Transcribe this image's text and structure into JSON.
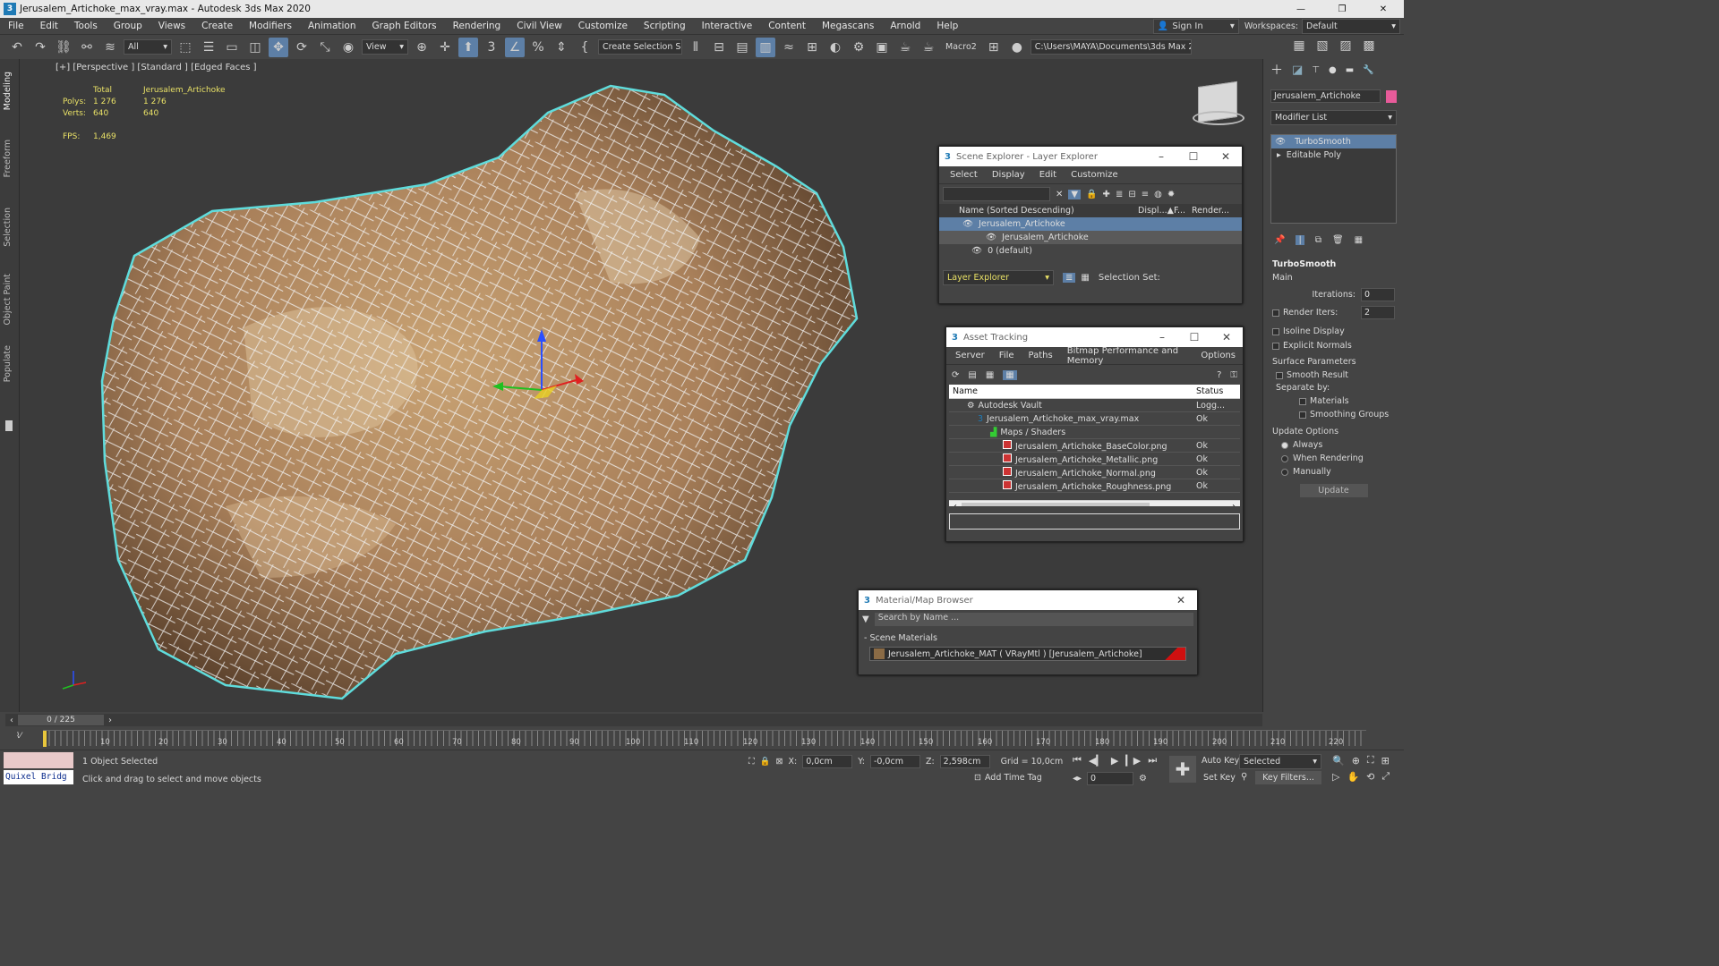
{
  "app": {
    "title": "Jerusalem_Artichoke_max_vray.max - Autodesk 3ds Max 2020",
    "window_controls": [
      "—",
      "❐",
      "✕"
    ]
  },
  "menu": [
    "File",
    "Edit",
    "Tools",
    "Group",
    "Views",
    "Create",
    "Modifiers",
    "Animation",
    "Graph Editors",
    "Rendering",
    "Civil View",
    "Customize",
    "Scripting",
    "Interactive",
    "Content",
    "Megascans",
    "Arnold",
    "Help"
  ],
  "account": {
    "sign_in": "Sign In",
    "workspaces_label": "Workspaces:",
    "workspace": "Default"
  },
  "toolbar": {
    "filter": "All",
    "view": "View",
    "selection_set": "Create Selection Se",
    "macro": "Macro2",
    "path": "C:\\Users\\MAYA\\Documents\\3ds Max 2020"
  },
  "left_tabs": [
    "Modeling",
    "Freeform",
    "Selection",
    "Object Paint",
    "Populate"
  ],
  "viewport": {
    "label": "[+] [Perspective ] [Standard ] [Edged Faces ]",
    "stats": {
      "col_total": "Total",
      "col_obj": "Jerusalem_Artichoke",
      "polys_label": "Polys:",
      "polys_total": "1 276",
      "polys_obj": "1 276",
      "verts_label": "Verts:",
      "verts_total": "640",
      "verts_obj": "640",
      "fps_label": "FPS:",
      "fps": "1,469"
    }
  },
  "scene_explorer": {
    "title": "Scene Explorer - Layer Explorer",
    "menu": [
      "Select",
      "Display",
      "Edit",
      "Customize"
    ],
    "col_name": "Name (Sorted Descending)",
    "col_disp": "Displ...▲",
    "col_f": "F...",
    "col_render": "Render...",
    "rows": [
      "Jerusalem_Artichoke",
      "Jerusalem_Artichoke",
      "0 (default)"
    ],
    "footer_layer": "Layer Explorer",
    "footer_sel": "Selection Set:"
  },
  "asset_tracking": {
    "title": "Asset Tracking",
    "menu": [
      "Server",
      "File",
      "Paths",
      "Bitmap Performance and Memory",
      "Options"
    ],
    "col_name": "Name",
    "col_status": "Status",
    "rows": [
      {
        "name": "Autodesk Vault",
        "status": "Logg..."
      },
      {
        "name": "Jerusalem_Artichoke_max_vray.max",
        "status": "Ok"
      },
      {
        "name": "Maps / Shaders",
        "status": ""
      },
      {
        "name": "Jerusalem_Artichoke_BaseColor.png",
        "status": "Ok"
      },
      {
        "name": "Jerusalem_Artichoke_Metallic.png",
        "status": "Ok"
      },
      {
        "name": "Jerusalem_Artichoke_Normal.png",
        "status": "Ok"
      },
      {
        "name": "Jerusalem_Artichoke_Roughness.png",
        "status": "Ok"
      }
    ]
  },
  "material_browser": {
    "title": "Material/Map Browser",
    "search_placeholder": "Search by Name ...",
    "section": "- Scene Materials",
    "item": "Jerusalem_Artichoke_MAT ( VRayMtl ) [Jerusalem_Artichoke]"
  },
  "command_panel": {
    "object_name": "Jerusalem_Artichoke",
    "modifier_list": "Modifier List",
    "stack": [
      "TurboSmooth",
      "Editable Poly"
    ],
    "rollout": "TurboSmooth",
    "main": "Main",
    "iterations_label": "Iterations:",
    "iterations": "0",
    "render_iters_label": "Render Iters:",
    "render_iters": "2",
    "isoline": "Isoline Display",
    "explicit": "Explicit Normals",
    "surface": "Surface Parameters",
    "smooth_result": "Smooth Result",
    "separate": "Separate by:",
    "materials": "Materials",
    "smoothing": "Smoothing Groups",
    "update_options": "Update Options",
    "always": "Always",
    "when_rendering": "When Rendering",
    "manually": "Manually",
    "update_btn": "Update"
  },
  "timeline": {
    "frame": "0 / 225",
    "ticks": [
      "10",
      "20",
      "30",
      "40",
      "50",
      "60",
      "70",
      "80",
      "90",
      "100",
      "110",
      "120",
      "130",
      "140",
      "150",
      "160",
      "170",
      "180",
      "190",
      "200",
      "210",
      "220"
    ]
  },
  "status": {
    "quixel": "Quixel Bridg",
    "selected_count": "1 Object Selected",
    "prompt": "Click and drag to select and move objects",
    "x_label": "X:",
    "x": "0,0cm",
    "y_label": "Y:",
    "y": "-0,0cm",
    "z_label": "Z:",
    "z": "2,598cm",
    "grid": "Grid = 10,0cm",
    "add_time_tag": "Add Time Tag",
    "auto_key": "Auto Key",
    "selected": "Selected",
    "set_key": "Set Key",
    "key_filters": "Key Filters...",
    "frame_field": "0"
  },
  "colors": {
    "selection_cyan": "#5fdcdc",
    "highlight_blue": "#5d7fa6",
    "stats_yellow": "#e8e066"
  }
}
